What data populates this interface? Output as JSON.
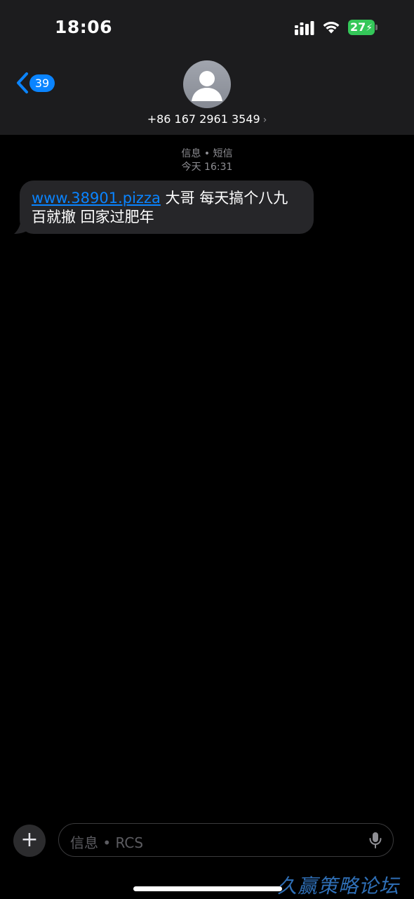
{
  "status_bar": {
    "time": "18:06",
    "battery_level": "27",
    "battery_color": "#34c759",
    "signal_icon": "cellular-signal-icon",
    "wifi_icon": "wifi-icon"
  },
  "nav": {
    "back_icon": "chevron-left-icon",
    "unread_count": "39",
    "accent_color": "#0a84ff"
  },
  "contact": {
    "avatar_icon": "person-silhouette-icon",
    "phone_number": "+86 167 2961 3549",
    "detail_chevron": "›"
  },
  "conversation": {
    "service_label": "信息 • 短信",
    "timestamp": "今天 16:31",
    "messages": [
      {
        "direction": "incoming",
        "link_text": "www.38901.pizza",
        "text_line1": " 大哥 每天搞个八九",
        "text_line2": "百就撤 回家过肥年"
      }
    ]
  },
  "composer": {
    "add_symbol": "+",
    "placeholder": "信息 • RCS",
    "mic_icon": "microphone-icon"
  },
  "watermark": "久赢策略论坛"
}
